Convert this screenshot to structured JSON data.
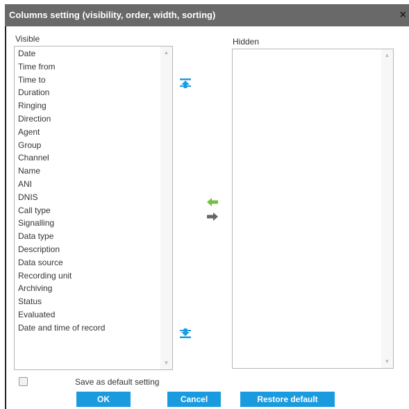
{
  "dialog": {
    "title": "Columns setting (visibility, order, width, sorting)",
    "close_glyph": "×"
  },
  "visible": {
    "label": "Visible",
    "items": [
      "Date",
      "Time from",
      "Time to",
      "Duration",
      "Ringing",
      "Direction",
      "Agent",
      "Group",
      "Channel",
      "Name",
      "ANI",
      "DNIS",
      "Call type",
      "Signalling",
      "Data type",
      "Description",
      "Data source",
      "Recording unit",
      "Archiving",
      "Status",
      "Evaluated",
      "Date and time of record"
    ]
  },
  "hidden": {
    "label": "Hidden",
    "items": []
  },
  "icons": {
    "move_top": "move-to-top-icon",
    "move_bottom": "move-to-bottom-icon",
    "move_left": "arrow-left-icon",
    "move_right": "arrow-right-icon"
  },
  "colors": {
    "titlebar": "#696969",
    "button": "#1a9be0",
    "arrow_blue": "#1a9be0",
    "arrow_green": "#76c043",
    "arrow_gray": "#666666"
  },
  "footer": {
    "save_default_label": "Save as default setting",
    "save_default_checked": false,
    "ok_label": "OK",
    "cancel_label": "Cancel",
    "restore_label": "Restore default"
  }
}
